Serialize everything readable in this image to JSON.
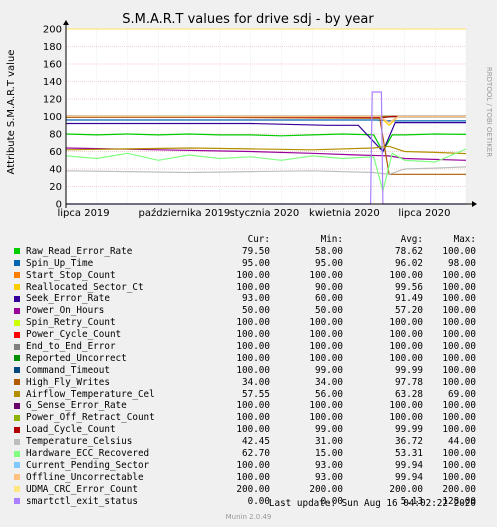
{
  "chart_data": {
    "type": "line",
    "title": "S.M.A.R.T values for drive sdj - by year",
    "ylabel": "Attribute S.M.A.R.T value",
    "side_label": "RRDTOOL / TOBI OETIKER",
    "ylim": [
      0,
      200
    ],
    "yticks": [
      0,
      20,
      40,
      60,
      80,
      100,
      120,
      140,
      160,
      180,
      200
    ],
    "xticks": [
      "lipca 2019",
      "października 2019",
      "stycznia 2020",
      "kwietnia 2020",
      "lipca 2020"
    ],
    "xtick_pos": [
      0.055,
      0.37,
      0.62,
      0.87,
      1.12
    ],
    "x_span_months": 13.0,
    "grid": true,
    "background": "#ffffff",
    "grid_color": "#f0a0a0",
    "series": [
      {
        "name": "Raw_Read_Error_Rate",
        "color": "#00cc00",
        "values": [
          [
            0,
            80
          ],
          [
            1,
            79
          ],
          [
            2,
            80
          ],
          [
            3,
            79
          ],
          [
            4,
            80
          ],
          [
            5,
            79
          ],
          [
            6,
            79
          ],
          [
            7,
            78
          ],
          [
            8,
            79
          ],
          [
            9,
            80
          ],
          [
            10,
            79
          ],
          [
            10.3,
            60
          ],
          [
            10.6,
            79
          ],
          [
            11,
            79
          ],
          [
            12,
            80
          ],
          [
            13,
            79.5
          ]
        ]
      },
      {
        "name": "Spin_Up_Time",
        "color": "#0066b3",
        "values": [
          [
            0,
            96
          ],
          [
            3,
            96
          ],
          [
            6,
            96
          ],
          [
            9,
            96
          ],
          [
            10.1,
            96
          ],
          [
            10.5,
            95
          ],
          [
            11,
            95
          ],
          [
            13,
            95
          ]
        ]
      },
      {
        "name": "Start_Stop_Count",
        "color": "#ff8000",
        "values": [
          [
            0,
            100
          ],
          [
            13,
            100
          ]
        ]
      },
      {
        "name": "Reallocated_Sector_Ct",
        "color": "#ffcc00",
        "values": [
          [
            0,
            100
          ],
          [
            10.2,
            100
          ],
          [
            10.5,
            90
          ],
          [
            10.8,
            100
          ],
          [
            13,
            100
          ]
        ]
      },
      {
        "name": "Seek_Error_Rate",
        "color": "#330099",
        "values": [
          [
            0,
            92
          ],
          [
            3,
            92
          ],
          [
            6,
            92
          ],
          [
            8.5,
            90
          ],
          [
            9.5,
            90
          ],
          [
            10.3,
            60
          ],
          [
            10.7,
            93
          ],
          [
            13,
            93
          ]
        ]
      },
      {
        "name": "Power_On_Hours",
        "color": "#990099",
        "values": [
          [
            0,
            64
          ],
          [
            3,
            62
          ],
          [
            6,
            60
          ],
          [
            8,
            58
          ],
          [
            9.5,
            56
          ],
          [
            10.5,
            55
          ],
          [
            11,
            52
          ],
          [
            13,
            50
          ]
        ]
      },
      {
        "name": "Spin_Retry_Count",
        "color": "#ccff00",
        "values": [
          [
            0,
            100
          ],
          [
            13,
            100
          ]
        ]
      },
      {
        "name": "Power_Cycle_Count",
        "color": "#ff0000",
        "values": [
          [
            0,
            100
          ],
          [
            13,
            100
          ]
        ]
      },
      {
        "name": "End_to_End_Error",
        "color": "#808080",
        "values": [
          [
            0,
            100
          ],
          [
            13,
            100
          ]
        ]
      },
      {
        "name": "Reported_Uncorrect",
        "color": "#008f00",
        "values": [
          [
            0,
            100
          ],
          [
            13,
            100
          ]
        ]
      },
      {
        "name": "Command_Timeout",
        "color": "#00487d",
        "values": [
          [
            0,
            100
          ],
          [
            10.3,
            99
          ],
          [
            10.6,
            100
          ],
          [
            13,
            100
          ]
        ]
      },
      {
        "name": "High_Fly_Writes",
        "color": "#b35a00",
        "values": [
          [
            0,
            99
          ],
          [
            5,
            99
          ],
          [
            10.2,
            98
          ],
          [
            10.5,
            34
          ],
          [
            10.8,
            34
          ],
          [
            13,
            34
          ]
        ]
      },
      {
        "name": "Airflow_Temperature_Cel",
        "color": "#b38f00",
        "values": [
          [
            0,
            62
          ],
          [
            2,
            63
          ],
          [
            4,
            64
          ],
          [
            6,
            63
          ],
          [
            8,
            62
          ],
          [
            10,
            64
          ],
          [
            10.5,
            66
          ],
          [
            11,
            60
          ],
          [
            12,
            59
          ],
          [
            13,
            57.55
          ]
        ]
      },
      {
        "name": "G_Sense_Error_Rate",
        "color": "#6b006b",
        "values": [
          [
            0,
            100
          ],
          [
            13,
            100
          ]
        ]
      },
      {
        "name": "Power_Off_Retract_Count",
        "color": "#8fb300",
        "values": [
          [
            0,
            100
          ],
          [
            13,
            100
          ]
        ]
      },
      {
        "name": "Load_Cycle_Count",
        "color": "#b30000",
        "values": [
          [
            0,
            100
          ],
          [
            10.3,
            99
          ],
          [
            10.6,
            100
          ],
          [
            13,
            100
          ]
        ]
      },
      {
        "name": "Temperature_Celsius",
        "color": "#bebebe",
        "values": [
          [
            0,
            38
          ],
          [
            2,
            37
          ],
          [
            4,
            36
          ],
          [
            6,
            37
          ],
          [
            8,
            38
          ],
          [
            10,
            36
          ],
          [
            10.5,
            34
          ],
          [
            11,
            40
          ],
          [
            12,
            41
          ],
          [
            13,
            42.45
          ]
        ]
      },
      {
        "name": "Hardware_ECC_Recovered",
        "color": "#80ff80",
        "values": [
          [
            0,
            55
          ],
          [
            1,
            52
          ],
          [
            2,
            58
          ],
          [
            3,
            50
          ],
          [
            4,
            56
          ],
          [
            5,
            52
          ],
          [
            6,
            54
          ],
          [
            7,
            50
          ],
          [
            8,
            55
          ],
          [
            9,
            52
          ],
          [
            10,
            54
          ],
          [
            10.3,
            15
          ],
          [
            10.6,
            58
          ],
          [
            11,
            50
          ],
          [
            12,
            48
          ],
          [
            13,
            62.7
          ]
        ]
      },
      {
        "name": "Current_Pending_Sector",
        "color": "#80c9ff",
        "values": [
          [
            0,
            100
          ],
          [
            10.2,
            100
          ],
          [
            10.5,
            93
          ],
          [
            10.8,
            100
          ],
          [
            13,
            100
          ]
        ]
      },
      {
        "name": "Offline_Uncorrectable",
        "color": "#ffc080",
        "values": [
          [
            0,
            100
          ],
          [
            10.2,
            100
          ],
          [
            10.5,
            93
          ],
          [
            10.8,
            100
          ],
          [
            13,
            100
          ]
        ]
      },
      {
        "name": "UDMA_CRC_Error_Count",
        "color": "#ffe680",
        "values": [
          [
            0,
            200
          ],
          [
            13,
            200
          ]
        ]
      },
      {
        "name": "smartctl_exit_status",
        "color": "#aa80ff",
        "values": [
          [
            0,
            0
          ],
          [
            9.9,
            0
          ],
          [
            9.95,
            128
          ],
          [
            10.25,
            128
          ],
          [
            10.3,
            0
          ],
          [
            13,
            0
          ]
        ]
      }
    ]
  },
  "legend": {
    "headers": {
      "cur": "Cur:",
      "min": "Min:",
      "avg": "Avg:",
      "max": "Max:"
    },
    "rows": [
      {
        "name": "Raw_Read_Error_Rate",
        "color": "#00cc00",
        "cur": "79.50",
        "min": "58.00",
        "avg": "78.62",
        "max": "100.00"
      },
      {
        "name": "Spin_Up_Time",
        "color": "#0066b3",
        "cur": "95.00",
        "min": "95.00",
        "avg": "96.02",
        "max": "98.00"
      },
      {
        "name": "Start_Stop_Count",
        "color": "#ff8000",
        "cur": "100.00",
        "min": "100.00",
        "avg": "100.00",
        "max": "100.00"
      },
      {
        "name": "Reallocated_Sector_Ct",
        "color": "#ffcc00",
        "cur": "100.00",
        "min": "90.00",
        "avg": "99.56",
        "max": "100.00"
      },
      {
        "name": "Seek_Error_Rate",
        "color": "#330099",
        "cur": "93.00",
        "min": "60.00",
        "avg": "91.49",
        "max": "100.00"
      },
      {
        "name": "Power_On_Hours",
        "color": "#990099",
        "cur": "50.00",
        "min": "50.00",
        "avg": "57.20",
        "max": "100.00"
      },
      {
        "name": "Spin_Retry_Count",
        "color": "#ccff00",
        "cur": "100.00",
        "min": "100.00",
        "avg": "100.00",
        "max": "100.00"
      },
      {
        "name": "Power_Cycle_Count",
        "color": "#ff0000",
        "cur": "100.00",
        "min": "100.00",
        "avg": "100.00",
        "max": "100.00"
      },
      {
        "name": "End_to_End_Error",
        "color": "#808080",
        "cur": "100.00",
        "min": "100.00",
        "avg": "100.00",
        "max": "100.00"
      },
      {
        "name": "Reported_Uncorrect",
        "color": "#008f00",
        "cur": "100.00",
        "min": "100.00",
        "avg": "100.00",
        "max": "100.00"
      },
      {
        "name": "Command_Timeout",
        "color": "#00487d",
        "cur": "100.00",
        "min": "99.00",
        "avg": "99.99",
        "max": "100.00"
      },
      {
        "name": "High_Fly_Writes",
        "color": "#b35a00",
        "cur": "34.00",
        "min": "34.00",
        "avg": "97.78",
        "max": "100.00"
      },
      {
        "name": "Airflow_Temperature_Cel",
        "color": "#b38f00",
        "cur": "57.55",
        "min": "56.00",
        "avg": "63.28",
        "max": "69.00"
      },
      {
        "name": "G_Sense_Error_Rate",
        "color": "#6b006b",
        "cur": "100.00",
        "min": "100.00",
        "avg": "100.00",
        "max": "100.00"
      },
      {
        "name": "Power_Off_Retract_Count",
        "color": "#8fb300",
        "cur": "100.00",
        "min": "100.00",
        "avg": "100.00",
        "max": "100.00"
      },
      {
        "name": "Load_Cycle_Count",
        "color": "#b30000",
        "cur": "100.00",
        "min": "99.00",
        "avg": "99.99",
        "max": "100.00"
      },
      {
        "name": "Temperature_Celsius",
        "color": "#bebebe",
        "cur": "42.45",
        "min": "31.00",
        "avg": "36.72",
        "max": "44.00"
      },
      {
        "name": "Hardware_ECC_Recovered",
        "color": "#80ff80",
        "cur": "62.70",
        "min": "15.00",
        "avg": "53.31",
        "max": "100.00"
      },
      {
        "name": "Current_Pending_Sector",
        "color": "#80c9ff",
        "cur": "100.00",
        "min": "93.00",
        "avg": "99.94",
        "max": "100.00"
      },
      {
        "name": "Offline_Uncorrectable",
        "color": "#ffc080",
        "cur": "100.00",
        "min": "93.00",
        "avg": "99.94",
        "max": "100.00"
      },
      {
        "name": "UDMA_CRC_Error_Count",
        "color": "#ffe680",
        "cur": "200.00",
        "min": "200.00",
        "avg": "200.00",
        "max": "200.00"
      },
      {
        "name": "smartctl_exit_status",
        "color": "#aa80ff",
        "cur": "0.00",
        "min": "0.00",
        "avg": "5.13",
        "max": "128.00"
      }
    ]
  },
  "last_update": "Last update: Sun Aug 16 04:02:22 2020",
  "munin_version": "Munin 2.0.49"
}
